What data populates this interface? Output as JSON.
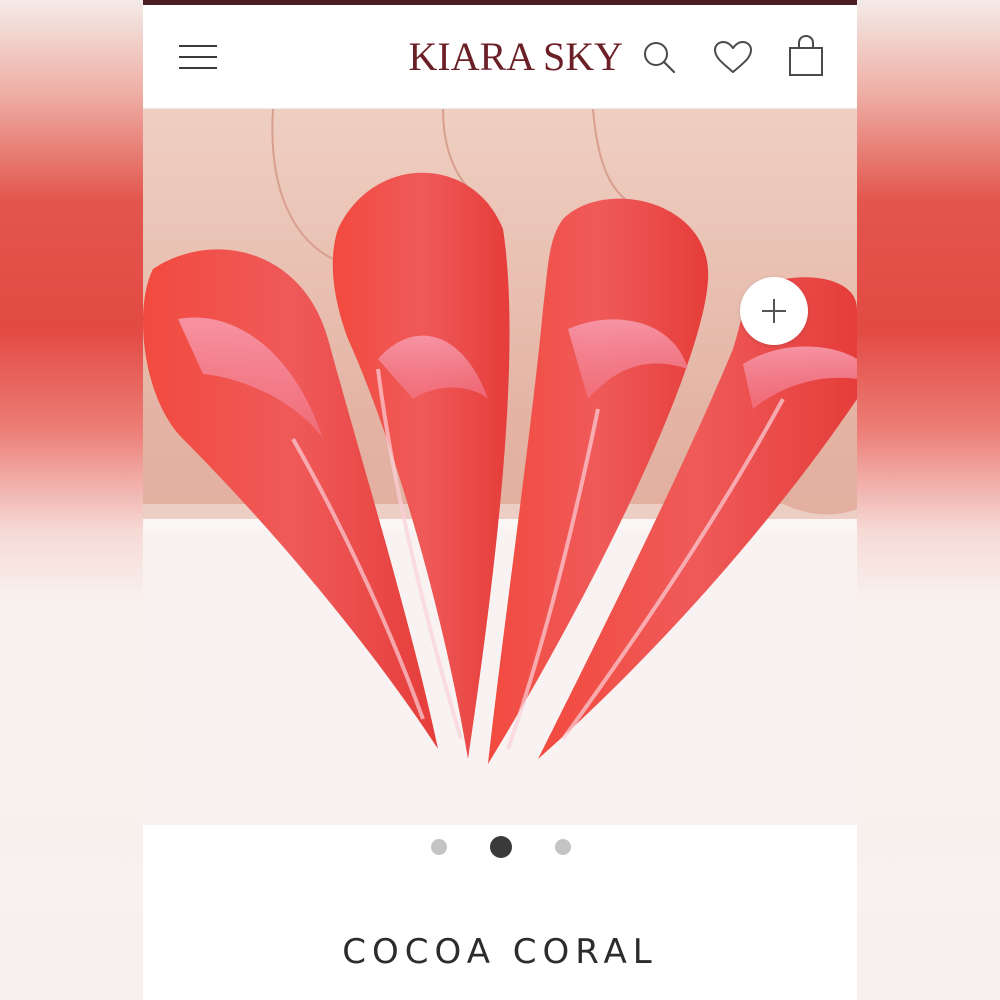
{
  "header": {
    "brand": "KIARA SKY",
    "menu_icon": "hamburger-menu-icon",
    "search_icon": "search-icon",
    "wishlist_icon": "heart-icon",
    "cart_icon": "shopping-bag-icon",
    "brand_color": "#6b1f26"
  },
  "gallery": {
    "image_subject": "four coral stiletto nails",
    "zoom_icon": "plus-icon",
    "pages": 3,
    "active_page": 2,
    "dot_active_color": "#3a3a3a",
    "dot_inactive_color": "#c4c4c4"
  },
  "product": {
    "name": "COCOA CORAL"
  },
  "colors": {
    "nail_main": "#f0463f",
    "nail_highlight": "#f48aa0",
    "skin": "#e8c2b2"
  }
}
